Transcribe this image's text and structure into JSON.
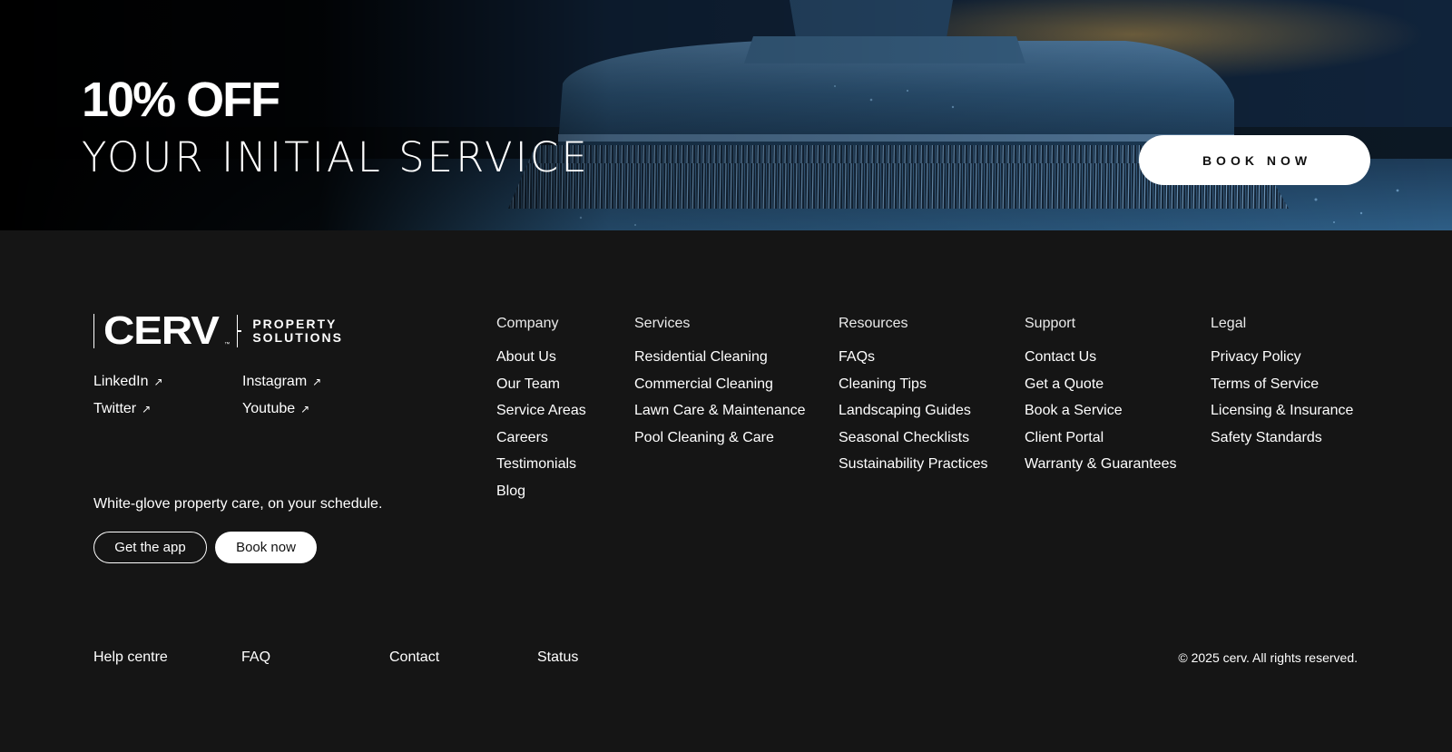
{
  "hero": {
    "title": "10% OFF",
    "subtitle": "YOUR INITIAL SERVICE",
    "book_label": "BOOK NOW",
    "accent_color": "#3a6a94"
  },
  "brand": {
    "name": "CERV",
    "tm": "™",
    "sub_line1": "PROPERTY",
    "sub_line2": "SOLUTIONS"
  },
  "social": [
    {
      "label": "LinkedIn",
      "icon": "external-arrow-icon"
    },
    {
      "label": "Instagram",
      "icon": "external-arrow-icon"
    },
    {
      "label": "Twitter",
      "icon": "external-arrow-icon"
    },
    {
      "label": "Youtube",
      "icon": "external-arrow-icon"
    }
  ],
  "tagline": "White-glove property care, on your schedule.",
  "cta": {
    "get_app": "Get the app",
    "book_now": "Book now"
  },
  "columns": [
    {
      "heading": "Company",
      "links": [
        "About Us",
        "Our Team",
        "Service Areas",
        "Careers",
        "Testimonials",
        "Blog"
      ]
    },
    {
      "heading": "Services",
      "links": [
        "Residential Cleaning",
        "Commercial Cleaning",
        "Lawn Care & Maintenance",
        "Pool Cleaning & Care"
      ]
    },
    {
      "heading": "Resources",
      "links": [
        "FAQs",
        "Cleaning Tips",
        "Landscaping Guides",
        "Seasonal Checklists",
        "Sustainability Practices"
      ]
    },
    {
      "heading": "Support",
      "links": [
        "Contact Us",
        "Get a Quote",
        "Book a Service",
        "Client Portal",
        "Warranty & Guarantees"
      ]
    },
    {
      "heading": "Legal",
      "links": [
        "Privacy Policy",
        "Terms of Service",
        "Licensing & Insurance",
        "Safety Standards"
      ]
    }
  ],
  "bottom_links": [
    "Help centre",
    "FAQ",
    "Contact",
    "Status"
  ],
  "copyright": "© 2025 cerv. All rights reserved."
}
